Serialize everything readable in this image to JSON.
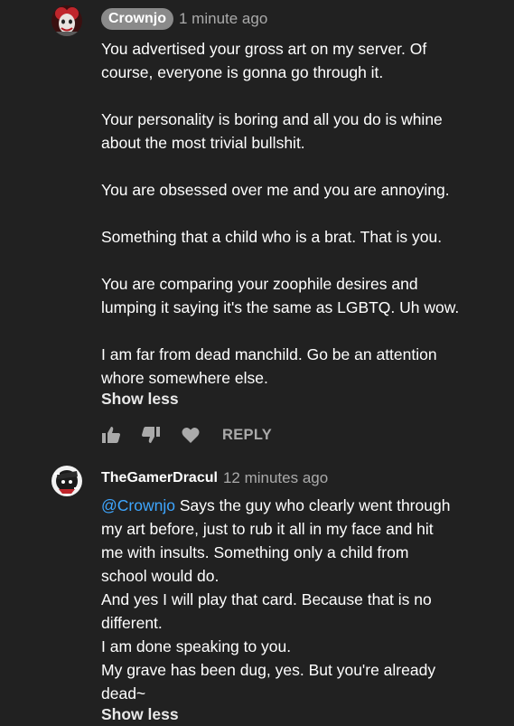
{
  "comments": [
    {
      "author": "Crownjo",
      "time": "1 minute ago",
      "lines": "You advertised your gross art on my server. Of\ncourse, everyone is gonna go through it.\n\nYour personality is boring and all you do is whine\nabout the most trivial bullshit.\n\nYou are obsessed over me and you are annoying.\n\nSomething that a child who is a brat. That is you.\n\nYou are comparing your zoophile desires and\nlumping it saying it's the same as LGBTQ. Uh wow.\n\nI am far from dead manchild. Go be an attention\nwhore somewhere else.",
      "show_less": "Show less",
      "reply_label": "REPLY"
    },
    {
      "author": "TheGamerDracul",
      "time": "12 minutes ago",
      "mention": "@Crownjo",
      "lines": " Says the guy who clearly went through\nmy art before, just to rub it all in my face and hit\nme with insults. Something only a child from\nschool would do.\nAnd yes I will play that card. Because that is no\ndifferent.\nI am done speaking to you.\nMy grave has been dug, yes. But you're already\ndead~",
      "show_less": "Show less"
    }
  ],
  "icons": {
    "like": "thumbs-up-icon",
    "dislike": "thumbs-down-icon",
    "heart": "heart-icon"
  },
  "colors": {
    "background": "#212121",
    "mention": "#3ea6ff",
    "author_pill": "#8a8a8a",
    "muted": "#aaaaaa"
  }
}
